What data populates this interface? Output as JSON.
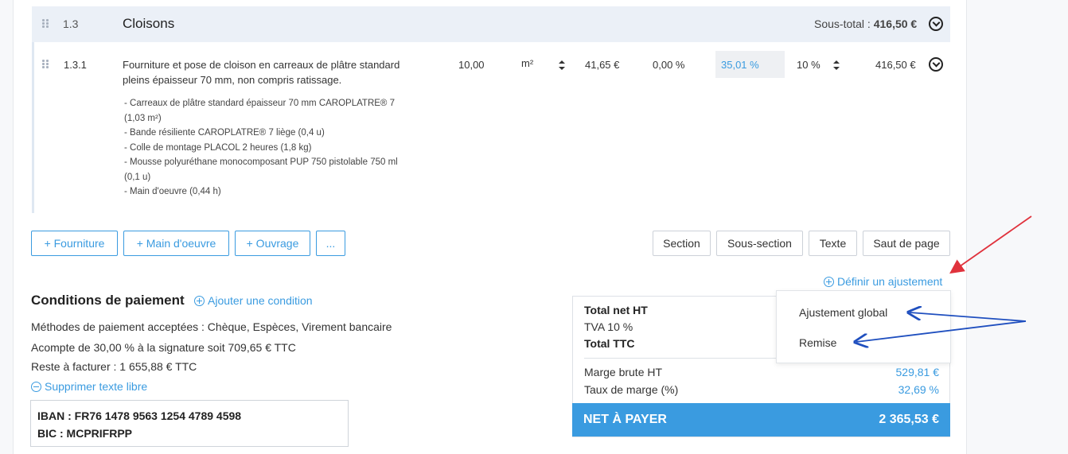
{
  "section": {
    "number": "1.3",
    "title": "Cloisons",
    "subtotal_label": "Sous-total :",
    "subtotal_value": "416,50 €"
  },
  "line": {
    "number": "1.3.1",
    "description": "Fourniture et pose de cloison en carreaux de plâtre standard pleins épaisseur 70 mm, non compris ratissage.",
    "components": [
      "- Carreaux de plâtre standard épaisseur 70 mm CAROPLATRE® 7",
      "(1,03 m²)",
      "- Bande résiliente CAROPLATRE® 7 liège (0,4 u)",
      "- Colle de montage PLACOL 2 heures (1,8 kg)",
      "- Mousse polyuréthane monocomposant PUP 750 pistolable 750 ml",
      "(0,1 u)",
      "- Main d'oeuvre (0,44 h)"
    ],
    "quantity": "10,00",
    "unit": "m²",
    "unit_price": "41,65 €",
    "discount": "0,00 %",
    "margin": "35,01 %",
    "tva": "10 %",
    "total": "416,50 €"
  },
  "add_buttons": [
    "+ Fourniture",
    "+ Main d'oeuvre",
    "+ Ouvrage",
    "..."
  ],
  "insert_buttons": [
    "Section",
    "Sous-section",
    "Texte",
    "Saut de page"
  ],
  "adjust_link": "Définir un ajustement",
  "payment": {
    "title": "Conditions de paiement",
    "add_condition": "Ajouter une condition",
    "methods": "Méthodes de paiement acceptées : Chèque, Espèces, Virement bancaire",
    "deposit": "Acompte de 30,00 % à la signature soit 709,65 € TTC",
    "remaining": "Reste à facturer : 1 655,88 € TTC",
    "remove_text": "Supprimer texte libre",
    "iban": "IBAN : FR76 1478 9563 1254 4789 4598",
    "bic": "BIC : MCPRIFRPP"
  },
  "totals": {
    "net_ht_label": "Total net HT",
    "tva_label": "TVA 10 %",
    "ttc_label": "Total TTC",
    "margin_ht_label": "Marge brute HT",
    "margin_ht_value": "529,81 €",
    "margin_rate_label": "Taux de marge (%)",
    "margin_rate_value": "32,69 %",
    "net_pay_label": "NET À PAYER",
    "net_pay_value": "2 365,53 €"
  },
  "dropdown": {
    "items": [
      "Ajustement global",
      "Remise"
    ]
  },
  "colors": {
    "accent": "#3a9be0",
    "section_bg": "#ebf0f7",
    "annotation_red": "#e0323c",
    "annotation_blue": "#1f4fbf"
  }
}
